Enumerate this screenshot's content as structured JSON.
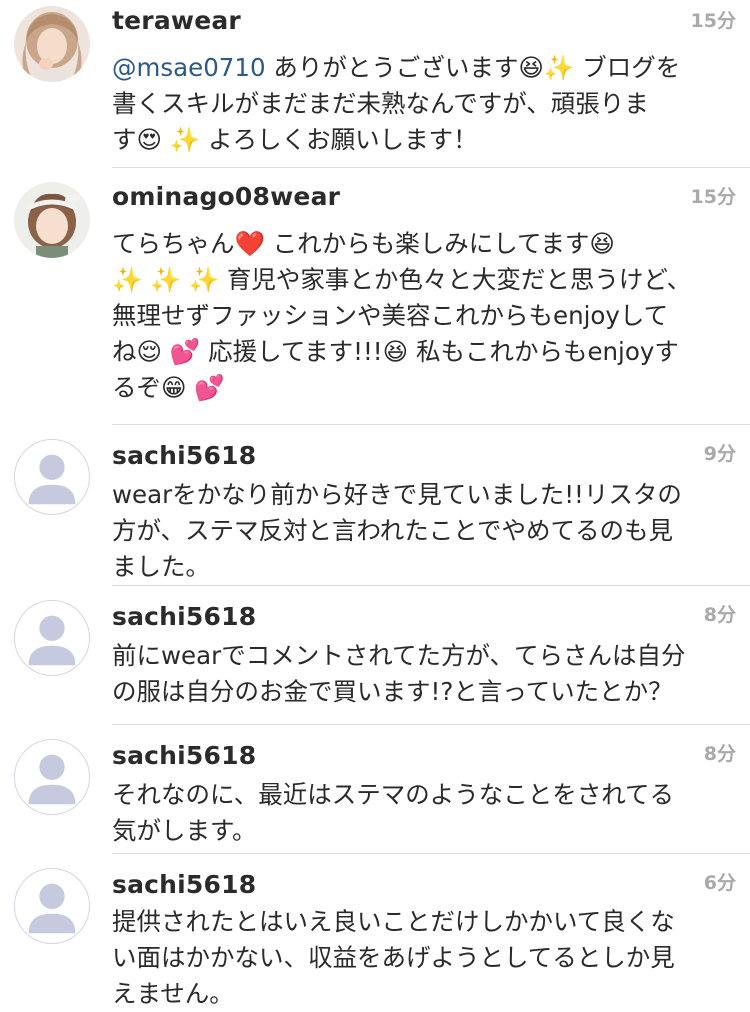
{
  "comments": [
    {
      "username": "terawear",
      "time": "15分",
      "avatar_icon": "profile-photo-woman",
      "lines": [
        {
          "mention": "@msae0710",
          "text": " ありがとうございます😆✨ ブログを"
        },
        {
          "mention": "",
          "text": "書くスキルがまだまだ未熟なんですが、頑張りま"
        },
        {
          "mention": "",
          "text": "す😍 ✨ よろしくお願いします！"
        }
      ]
    },
    {
      "username": "ominago08wear",
      "time": "15分",
      "avatar_icon": "profile-photo-child",
      "lines": [
        {
          "mention": "",
          "text": "てらちゃん❤️ これからも楽しみにしてます😆"
        },
        {
          "mention": "",
          "text": "✨ ✨ ✨ 育児や家事とか色々と大変だと思うけど、"
        },
        {
          "mention": "",
          "text": "無理せずファッションや美容これからもenjoyして"
        },
        {
          "mention": "",
          "text": "ね😌 💕 応援してます!!!😆 私もこれからもenjoyす"
        },
        {
          "mention": "",
          "text": "るぞ😁 💕"
        }
      ]
    },
    {
      "username": "sachi5618",
      "time": "9分",
      "avatar_icon": "default-avatar-icon",
      "lines": [
        {
          "mention": "",
          "text": "wearをかなり前から好きで見ていました!!リスタの"
        },
        {
          "mention": "",
          "text": "方が、ステマ反対と言われたことでやめてるのも見"
        },
        {
          "mention": "",
          "text": "ました。"
        }
      ]
    },
    {
      "username": "sachi5618",
      "time": "8分",
      "avatar_icon": "default-avatar-icon",
      "lines": [
        {
          "mention": "",
          "text": "前にwearでコメントされてた方が、てらさんは自分"
        },
        {
          "mention": "",
          "text": "の服は自分のお金で買います!?と言っていたとか？"
        }
      ]
    },
    {
      "username": "sachi5618",
      "time": "8分",
      "avatar_icon": "default-avatar-icon",
      "lines": [
        {
          "mention": "",
          "text": "それなのに、最近はステマのようなことをされてる"
        },
        {
          "mention": "",
          "text": "気がします。"
        }
      ]
    },
    {
      "username": "sachi5618",
      "time": "6分",
      "avatar_icon": "default-avatar-icon",
      "lines": [
        {
          "mention": "",
          "text": "提供されたとはいえ良いことだけしかかいて良くな"
        },
        {
          "mention": "",
          "text": "い面はかかない、収益をあげようとしてるとしか見"
        },
        {
          "mention": "",
          "text": "えません。"
        }
      ]
    }
  ],
  "colors": {
    "mention": "#2b5a8a",
    "time": "#a9a9a9",
    "divider": "#dcdcdc",
    "default_avatar_fill": "#c7c9de"
  }
}
